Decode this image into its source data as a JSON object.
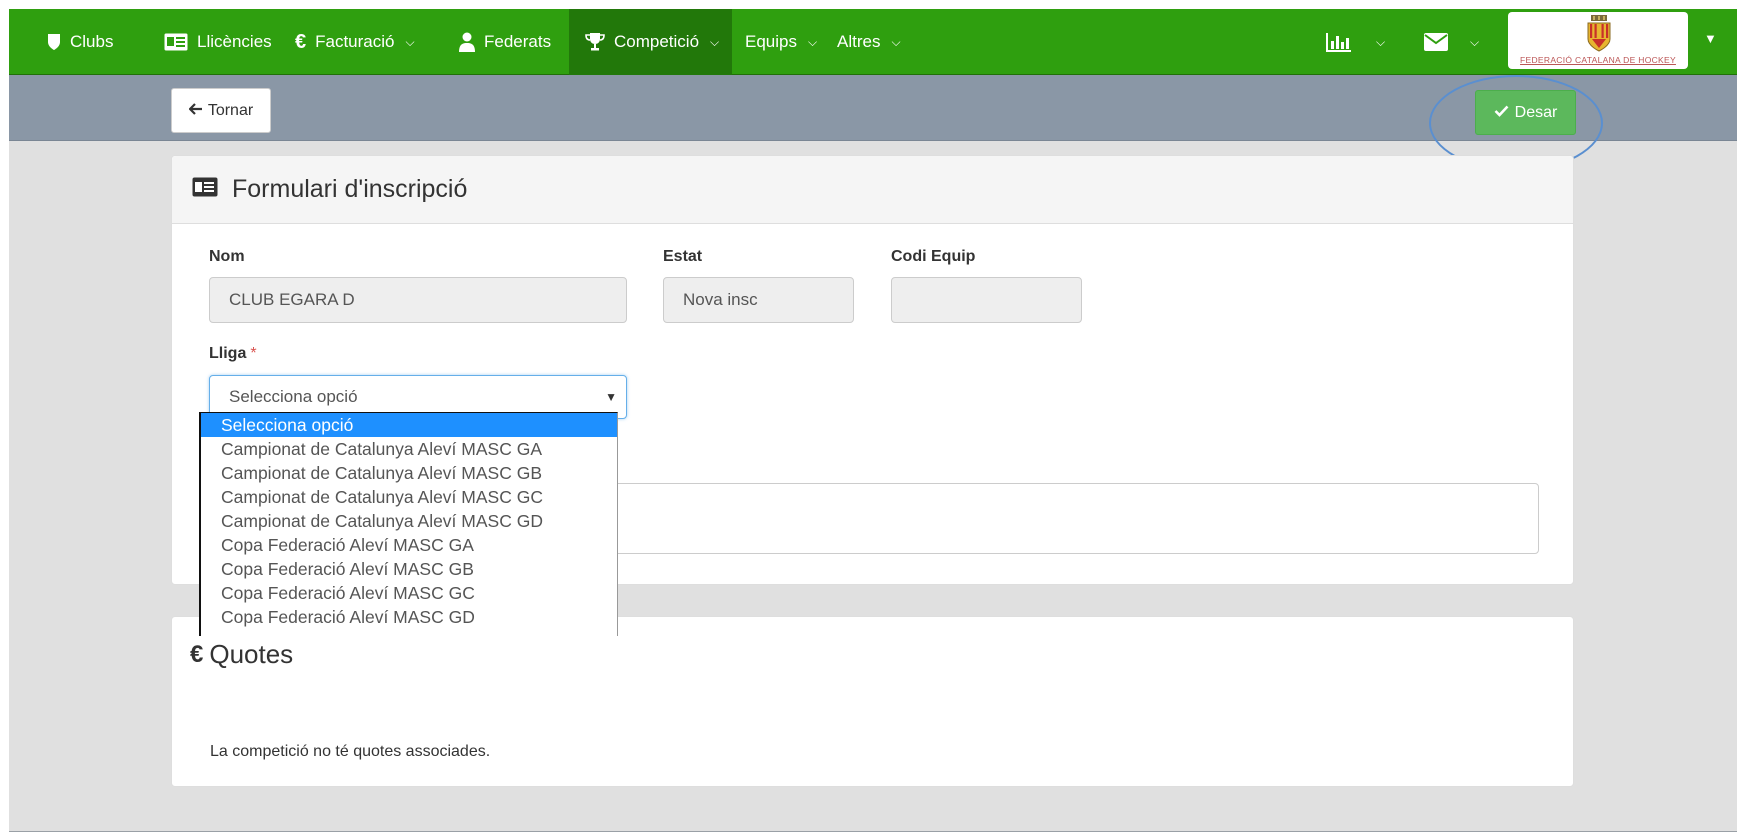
{
  "nav": {
    "items": [
      {
        "label": "Clubs",
        "icon": "shield-icon",
        "has_dropdown": false,
        "active": false
      },
      {
        "label": "Llicències",
        "icon": "id-card-icon",
        "has_dropdown": false,
        "active": false
      },
      {
        "label": "Facturació",
        "icon": "euro-icon",
        "has_dropdown": true,
        "active": false
      },
      {
        "label": "Federats",
        "icon": "user-icon",
        "has_dropdown": false,
        "active": false
      },
      {
        "label": "Competició",
        "icon": "trophy-icon",
        "has_dropdown": true,
        "active": true
      },
      {
        "label": "Equips",
        "icon": "",
        "has_dropdown": true,
        "active": false
      },
      {
        "label": "Altres",
        "icon": "",
        "has_dropdown": true,
        "active": false
      }
    ],
    "right_icons": [
      "bar-chart-icon",
      "envelope-icon"
    ],
    "logo_text": "FEDERACIÓ CATALANA DE HOCKEY",
    "colors": {
      "nav": "#2f9f0f",
      "nav_active": "#22780a"
    }
  },
  "toolbar": {
    "back_label": "Tornar",
    "save_label": "Desar",
    "colors": {
      "toolbar": "#8a97a6",
      "save": "#5cb85c"
    }
  },
  "form": {
    "title": "Formulari d'inscripció",
    "title_icon": "id-card-icon",
    "nom_label": "Nom",
    "nom_value": "CLUB EGARA D",
    "estat_label": "Estat",
    "estat_value": "Nova insc",
    "codi_label": "Codi Equip",
    "codi_value": "",
    "lliga_label": "Lliga",
    "lliga_required": "*",
    "lliga_selected": "Selecciona opció"
  },
  "dropdown_options": [
    "Selecciona opció",
    "Campionat de Catalunya Aleví MASC GA",
    "Campionat de Catalunya Aleví MASC GB",
    "Campionat de Catalunya Aleví MASC GC",
    "Campionat de Catalunya Aleví MASC GD",
    "Copa Federació Aleví MASC GA",
    "Copa Federació Aleví MASC GB",
    "Copa Federació Aleví MASC GC",
    "Copa Federació Aleví MASC GD"
  ],
  "quotes": {
    "title": "Quotes",
    "icon": "euro-icon",
    "note": "La competició no té quotes associades."
  }
}
